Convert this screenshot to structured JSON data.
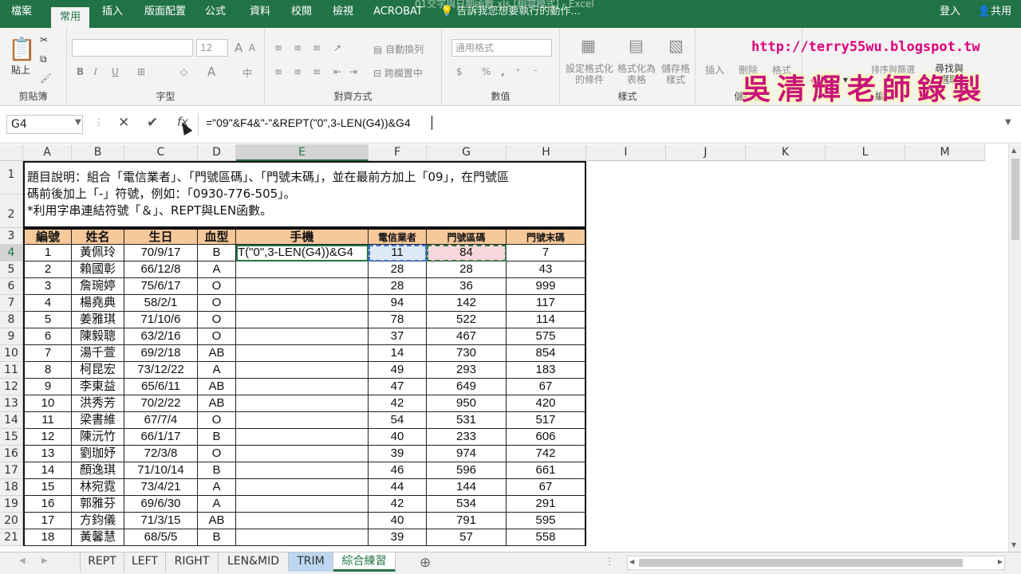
{
  "ribbon_tabs": [
    "檔案",
    "常用",
    "插入",
    "版面配置",
    "公式",
    "資料",
    "校閱",
    "檢視",
    "ACROBAT"
  ],
  "title_partial": "01交字與日期函數.xls [相容模式] - Excel",
  "tell_me": "告訴我您想要執行的動作...",
  "signin": "登入",
  "share": "共用",
  "ribbon": {
    "paste": "貼上",
    "clipboard": "剪貼簿",
    "font_size": "12",
    "font_group": "字型",
    "wrap_text": "自動換列",
    "merge_center": "跨欄置中",
    "alignment_group": "對齊方式",
    "number_format": "通用格式",
    "number_group": "數值",
    "cond_format": "設定格式化的條件",
    "format_table": "格式化為表格",
    "cell_styles": "儲存格樣式",
    "styles_group": "樣式",
    "insert": "插入",
    "delete": "刪除",
    "format": "格式",
    "cells_group": "儲存格",
    "clear": "清除",
    "sort_filter": "排序與篩選",
    "find_select": "尋找與選取",
    "editing_group": "編輯"
  },
  "watermark": {
    "url": "http://terry55wu.blogspot.tw",
    "author": "吳清輝老師錄製"
  },
  "name_box": "G4",
  "formula": "=\"09\"&F4&\"-\"&REPT(\"0\",3-LEN(G4))&G4",
  "columns": [
    "A",
    "B",
    "C",
    "D",
    "E",
    "F",
    "G",
    "H",
    "I",
    "J",
    "K",
    "L",
    "M"
  ],
  "note": [
    "題目說明：組合「電信業者」、「門號區碼」、「門號末碼」，並在最前方加上「09」，在門號區",
    "碼前後加上「-」符號，例如：「0930-776-505」。",
    "*利用字串連結符號「＆」、REPT與LEN函數。"
  ],
  "headers": [
    "編號",
    "姓名",
    "生日",
    "血型",
    "手機",
    "電信業者",
    "門號區碼",
    "門號末碼"
  ],
  "edit_text": "T(\"0\",3-LEN(G4))&G4",
  "rows": [
    [
      "1",
      "黃佩玲",
      "70/9/17",
      "B",
      "",
      "11",
      "84",
      "7"
    ],
    [
      "2",
      "賴國彰",
      "66/12/8",
      "A",
      "",
      "28",
      "28",
      "43"
    ],
    [
      "3",
      "詹琬婷",
      "75/6/17",
      "O",
      "",
      "28",
      "36",
      "999"
    ],
    [
      "4",
      "楊堯典",
      "58/2/1",
      "O",
      "",
      "94",
      "142",
      "117"
    ],
    [
      "5",
      "姜雅琪",
      "71/10/6",
      "O",
      "",
      "78",
      "522",
      "114"
    ],
    [
      "6",
      "陳毅聰",
      "63/2/16",
      "O",
      "",
      "37",
      "467",
      "575"
    ],
    [
      "7",
      "湯千萱",
      "69/2/18",
      "AB",
      "",
      "14",
      "730",
      "854"
    ],
    [
      "8",
      "柯昆宏",
      "73/12/22",
      "A",
      "",
      "49",
      "293",
      "183"
    ],
    [
      "9",
      "李東益",
      "65/6/11",
      "AB",
      "",
      "47",
      "649",
      "67"
    ],
    [
      "10",
      "洪秀芳",
      "70/2/22",
      "AB",
      "",
      "42",
      "950",
      "420"
    ],
    [
      "11",
      "梁書維",
      "67/7/4",
      "O",
      "",
      "54",
      "531",
      "517"
    ],
    [
      "12",
      "陳沅竹",
      "66/1/17",
      "B",
      "",
      "40",
      "233",
      "606"
    ],
    [
      "13",
      "劉珈妤",
      "72/3/8",
      "O",
      "",
      "39",
      "974",
      "742"
    ],
    [
      "14",
      "顏逸琪",
      "71/10/14",
      "B",
      "",
      "46",
      "596",
      "661"
    ],
    [
      "15",
      "林宛霓",
      "73/4/21",
      "A",
      "",
      "44",
      "144",
      "67"
    ],
    [
      "16",
      "郭雅芬",
      "69/6/30",
      "A",
      "",
      "42",
      "534",
      "291"
    ],
    [
      "17",
      "方鈞儀",
      "71/3/15",
      "AB",
      "",
      "40",
      "791",
      "595"
    ],
    [
      "18",
      "黃馨慧",
      "68/5/5",
      "B",
      "",
      "39",
      "57",
      "558"
    ]
  ],
  "row_numbers": [
    "1",
    "2",
    "3",
    "4",
    "5",
    "6",
    "7",
    "8",
    "9",
    "10",
    "11",
    "12",
    "13",
    "14",
    "15",
    "16",
    "17",
    "18",
    "19",
    "20",
    "21"
  ],
  "sheets": [
    "REPT",
    "LEFT",
    "RIGHT",
    "LEN&MID",
    "TRIM",
    "綜合練習"
  ],
  "colors": {
    "excel_green": "#217346",
    "header_fill": "#f7c89a",
    "trim_tab": "#bcd7ef",
    "f4_fill": "#dde9f7",
    "g4_fill": "#f7d6dd"
  }
}
